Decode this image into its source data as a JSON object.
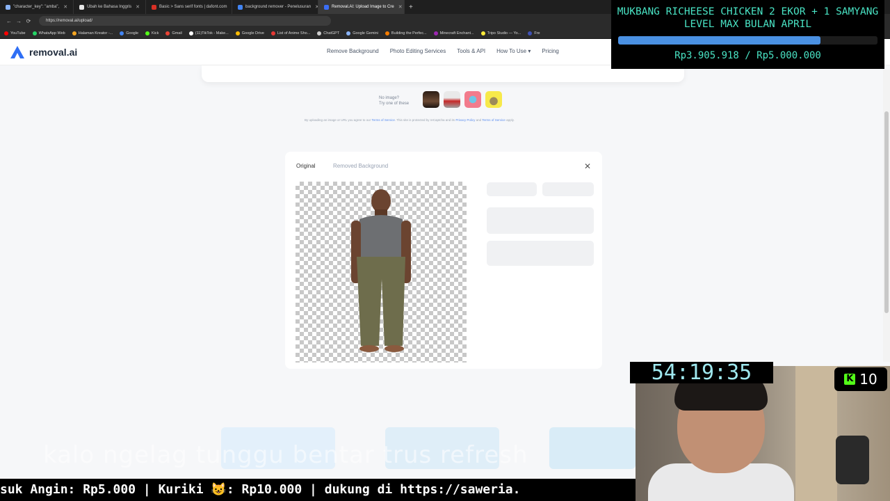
{
  "browser": {
    "tabs": [
      {
        "title": "\"character_key\": \"amba\",",
        "color": "#8ab4f8"
      },
      {
        "title": "Ubah ke Bahasa Inggris",
        "color": "#e5e5e5"
      },
      {
        "title": "Basic > Sans serif fonts | dafont.com",
        "color": "#d93025"
      },
      {
        "title": "background remover - Penelusuran",
        "color": "#4285f4"
      },
      {
        "title": "Removal.AI: Upload Image to Cre",
        "color": "#3b6ef5"
      }
    ],
    "active_tab": 4,
    "url": "https://removal.ai/upload/",
    "bookmarks": [
      {
        "label": "YouTube",
        "color": "#ff0000"
      },
      {
        "label": "WhatsApp Web",
        "color": "#25d366"
      },
      {
        "label": "Halaman Kreator -...",
        "color": "#f5a623"
      },
      {
        "label": "Google",
        "color": "#4285f4"
      },
      {
        "label": "Kick",
        "color": "#53fc18"
      },
      {
        "label": "Gmail",
        "color": "#ea4335"
      },
      {
        "label": "(11)TikTok - Make...",
        "color": "#ffffff"
      },
      {
        "label": "Google Drive",
        "color": "#fbbc04"
      },
      {
        "label": "List of Anime Sho...",
        "color": "#e53935"
      },
      {
        "label": "ChatGPT",
        "color": "#cccccc"
      },
      {
        "label": "Google Gemini",
        "color": "#8ab4f8"
      },
      {
        "label": "Building the Perfec...",
        "color": "#f57c00"
      },
      {
        "label": "Minecraft Enchant...",
        "color": "#9c27b0"
      },
      {
        "label": "Tripo Studio — Yo...",
        "color": "#ffeb3b"
      },
      {
        "label": "Fre",
        "color": "#3f51b5"
      }
    ]
  },
  "site": {
    "brand": "removal.ai",
    "nav": [
      "Remove Background",
      "Photo Editing Services",
      "Tools & API",
      "How To Use ▾",
      "Pricing"
    ]
  },
  "upload": {
    "no_image_line1": "No image?",
    "no_image_line2": "Try one of these",
    "legal_prefix": "By uploading an image or URL you agree to our",
    "terms": "Terms of Service",
    "legal_mid": ". This site is protected by reCaptcha and its",
    "privacy": "Privacy Policy",
    "and": "and",
    "terms2": "Terms of Service",
    "legal_suffix": "apply."
  },
  "result": {
    "tab_original": "Original",
    "tab_removed": "Removed Background"
  },
  "stream": {
    "goal_title": "MUKBANG RICHEESE CHICKEN 2 EKOR + 1 SAMYANG LEVEL MAX BULAN APRIL",
    "goal_amount": "Rp3.905.918 / Rp5.000.000",
    "goal_progress": 0.781,
    "timer": "54:19:35",
    "kick_viewers": "10",
    "ticker": "suk Angin: Rp5.000 | Kuriki 😺: Rp10.000 |  dukung di https://saweria.",
    "caption": "kalo ngelag tunggu bentar trus refresh"
  }
}
